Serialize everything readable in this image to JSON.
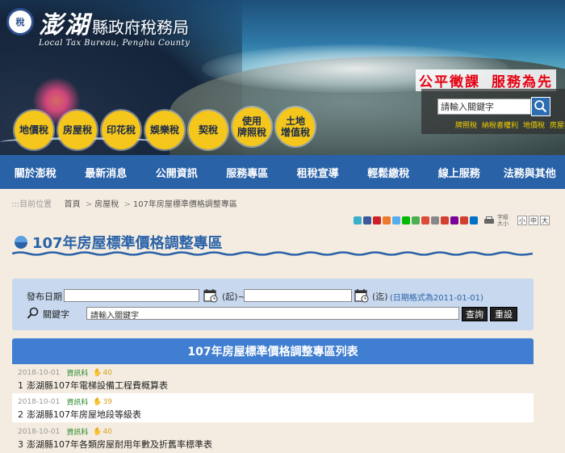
{
  "header": {
    "logo_text": "稅",
    "site_name_big": "澎湖",
    "site_name_cn": "縣政府稅務局",
    "site_name_en": "Local Tax Bureau, Penghu County",
    "slogan": [
      "公平徵課",
      "服務為先"
    ],
    "search": {
      "placeholder": "請輸入關鍵字",
      "value": "請輸入關鍵字"
    },
    "hot_keys": [
      "牌照稅",
      "納稅者權利",
      "地價稅",
      "房屋稅"
    ]
  },
  "tax_buttons": [
    {
      "label": "地價稅"
    },
    {
      "label": "房屋稅"
    },
    {
      "label": "印花稅"
    },
    {
      "label": "娛樂稅"
    },
    {
      "label": "契稅"
    },
    {
      "label": "使用\n牌照稅"
    },
    {
      "label": "土地\n增值稅"
    }
  ],
  "nav": [
    "關於澎稅",
    "最新消息",
    "公開資訊",
    "服務專區",
    "租稅宣導",
    "輕鬆繳稅",
    "線上服務",
    "法務與其他"
  ],
  "breadcrumb": {
    "prefix": ":::目前位置",
    "items": [
      "首頁",
      "房屋稅",
      "107年房屋標準價格調整專區"
    ]
  },
  "font_size": {
    "label": "字級大小",
    "options": [
      "小",
      "中",
      "大"
    ]
  },
  "page_title": "107年房屋標準價格調整專區",
  "search_form": {
    "date_label": "發布日期",
    "start_text": "(起)~",
    "end_text": "(迄)",
    "date_hint": "(日期格式為2011-01-01)",
    "keyword_label": "關鍵字",
    "keyword_value": "請輸入關鍵字",
    "query_button": "查詢",
    "reset_button": "重設"
  },
  "list": {
    "header": "107年房屋標準價格調整專區列表",
    "items": [
      {
        "date": "2018-10-01",
        "dept": "資訊科",
        "views": "40",
        "num": "1",
        "title": "澎湖縣107年電梯設備工程費概算表"
      },
      {
        "date": "2018-10-01",
        "dept": "資訊科",
        "views": "39",
        "num": "2",
        "title": "澎湖縣107年房屋地段等級表"
      },
      {
        "date": "2018-10-01",
        "dept": "資訊科",
        "views": "40",
        "num": "3",
        "title": "澎湖縣107年各類房屋耐用年數及折舊率標準表"
      }
    ]
  },
  "colors": {
    "nav_bg": "#2a62a8",
    "tax_button": "#f5c61b",
    "slogan": "#e60012",
    "list_header": "#3f7ed0",
    "form_bg": "#c7d8ef"
  }
}
